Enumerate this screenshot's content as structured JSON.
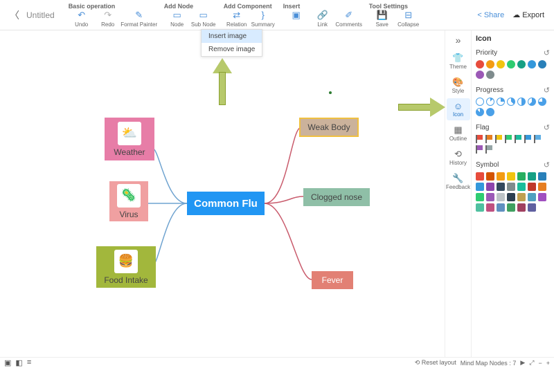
{
  "doc_title": "Untitled",
  "toolbar": {
    "groups": {
      "basic": {
        "label": "Basic operation",
        "undo": "Undo",
        "redo": "Redo",
        "format_painter": "Format Painter"
      },
      "add_node": {
        "label": "Add Node",
        "node": "Node",
        "sub_node": "Sub Node"
      },
      "add_component": {
        "label": "Add Component",
        "relation": "Relation",
        "summary": "Summary"
      },
      "insert": {
        "label": "Insert",
        "image": "Image",
        "link": "Link",
        "comments": "Comments"
      },
      "tool_settings": {
        "label": "Tool Settings",
        "save": "Save",
        "collapse": "Collapse"
      }
    },
    "share": "Share",
    "export": "Export"
  },
  "insert_menu": {
    "insert_image": "Insert image",
    "remove_image": "Remove image"
  },
  "nodes": {
    "center": "Common Flu",
    "weather": "Weather",
    "virus": "Virus",
    "food": "Food Intake",
    "weak": "Weak Body",
    "clogged": "Clogged nose",
    "fever": "Fever"
  },
  "right_tabs": {
    "theme": "Theme",
    "style": "Style",
    "icon": "Icon",
    "outline": "Outline",
    "history": "History",
    "feedback": "Feedback"
  },
  "icon_panel": {
    "title": "Icon",
    "priority": "Priority",
    "progress": "Progress",
    "flag": "Flag",
    "symbol": "Symbol",
    "priority_colors": [
      "#e74c3c",
      "#f39c12",
      "#f1c40f",
      "#2ecc71",
      "#16a085",
      "#3498db",
      "#2980b9",
      "#9b59b6",
      "#7f8c8d"
    ],
    "progress_values": [
      0,
      12,
      25,
      37,
      50,
      62,
      75,
      87,
      100
    ],
    "flag_colors": [
      "#e74c3c",
      "#e67e22",
      "#f1c40f",
      "#2ecc71",
      "#1abc9c",
      "#3498db",
      "#5dade2",
      "#9b59b6",
      "#95a5a6"
    ],
    "symbol_colors": [
      "#e74c3c",
      "#d35400",
      "#f39c12",
      "#f1c40f",
      "#27ae60",
      "#16a085",
      "#2980b9",
      "#3498db",
      "#8e44ad",
      "#34495e",
      "#7f8c8d",
      "#1abc9c",
      "#c0392b",
      "#e67e22",
      "#2ecc71",
      "#9b59b6",
      "#bdc3c7",
      "#2c3e50",
      "#c0a050",
      "#50a0c0",
      "#a050c0",
      "#50c0a0",
      "#c05080",
      "#6090c0",
      "#40a060",
      "#a04060",
      "#6060a0"
    ]
  },
  "bottom": {
    "reset_layout": "Reset layout",
    "mind_map_nodes": "Mind Map Nodes",
    "node_count": "7"
  }
}
